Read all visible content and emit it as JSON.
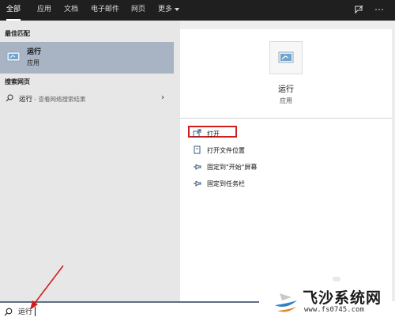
{
  "topbar": {
    "tabs": [
      {
        "label": "全部",
        "active": true
      },
      {
        "label": "应用",
        "active": false
      },
      {
        "label": "文档",
        "active": false
      },
      {
        "label": "电子邮件",
        "active": false
      },
      {
        "label": "网页",
        "active": false
      },
      {
        "label": "更多",
        "active": false,
        "has_dropdown": true
      }
    ],
    "icons": [
      "feedback-icon",
      "more-options-icon"
    ]
  },
  "left_panel": {
    "best_match_header": "最佳匹配",
    "best_match": {
      "title": "运行",
      "subtitle": "应用",
      "icon": "run-app-icon"
    },
    "web_header": "搜索网页",
    "web_result": {
      "query": "运行",
      "suffix": " - 查看网络搜索结果",
      "icon": "search-icon"
    }
  },
  "right_panel": {
    "app_title": "运行",
    "app_type": "应用",
    "actions": [
      {
        "label": "打开",
        "icon": "open-icon",
        "highlighted": true
      },
      {
        "label": "打开文件位置",
        "icon": "file-location-icon"
      },
      {
        "label": "固定到\"开始\"屏幕",
        "icon": "pin-start-icon"
      },
      {
        "label": "固定到任务栏",
        "icon": "pin-taskbar-icon"
      }
    ]
  },
  "search_bar": {
    "value": "运行",
    "icon": "search-icon"
  },
  "watermark": {
    "title": "飞沙系统网",
    "url": "www.fs0745.com"
  },
  "colors": {
    "topbar": "#1f1f1f",
    "selection": "#a8b4c4",
    "highlight_box": "#d21d1d",
    "arrow": "#d21d1d"
  }
}
